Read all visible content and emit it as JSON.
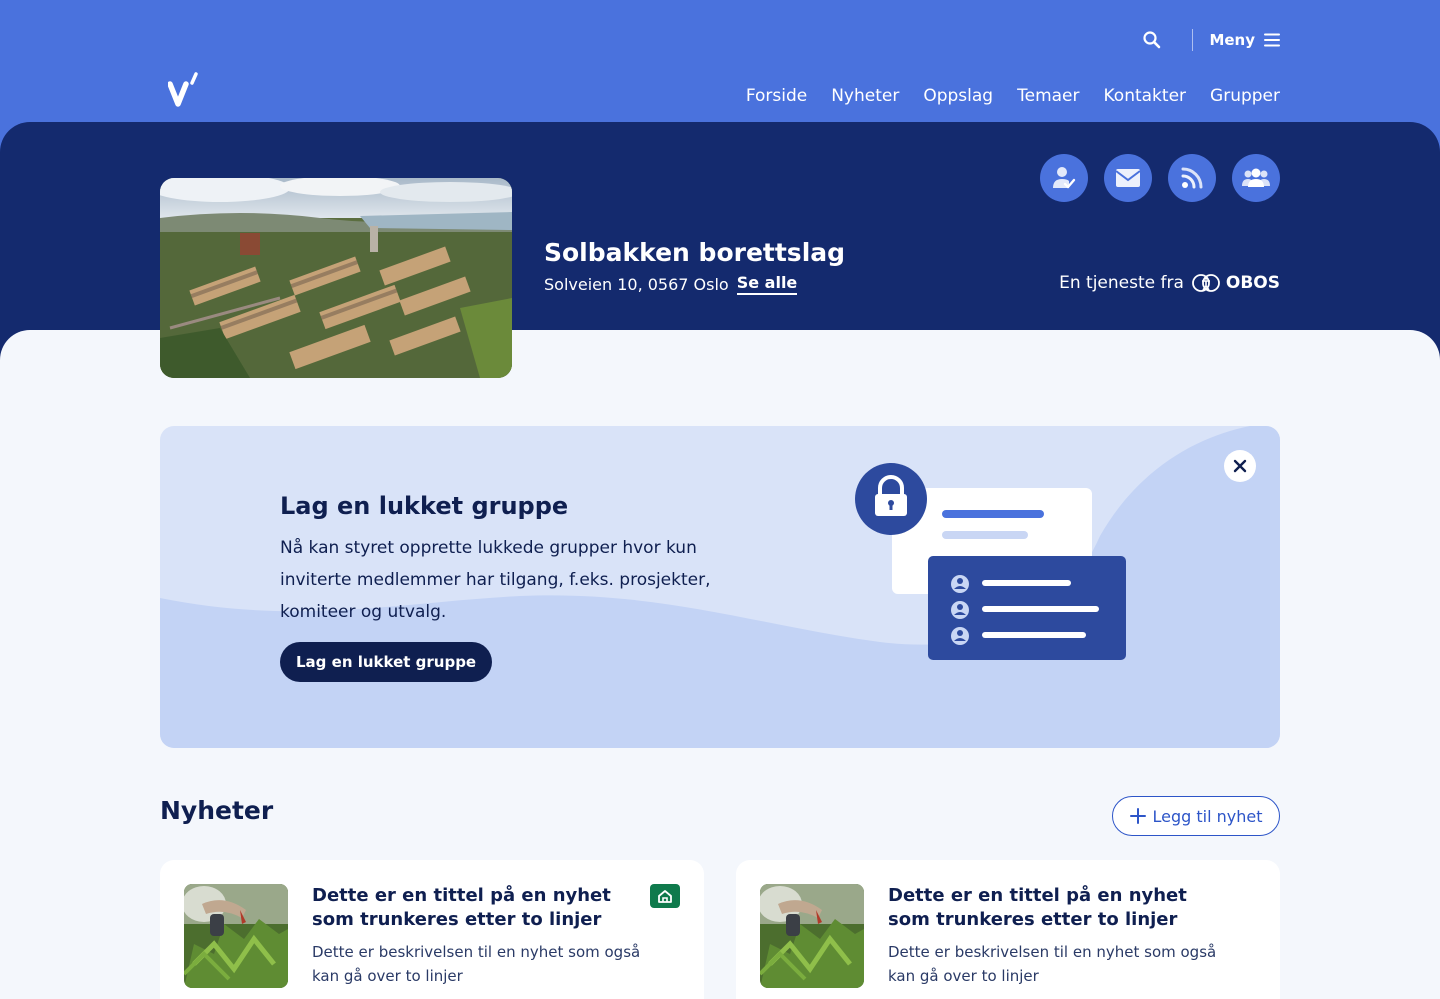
{
  "header": {
    "menu_label": "Meny",
    "nav": [
      "Forside",
      "Nyheter",
      "Oppslag",
      "Temaer",
      "Kontakter",
      "Grupper"
    ]
  },
  "org": {
    "name": "Solbakken borettslag",
    "address": "Solveien 10, 0567 Oslo",
    "see_all": "Se alle",
    "service_prefix": "En tjeneste fra",
    "service_brand": "OBOS"
  },
  "quick_actions": [
    "user-check-icon",
    "envelope-icon",
    "rss-icon",
    "group-icon"
  ],
  "promo": {
    "title": "Lag en lukket gruppe",
    "text": "Nå kan styret opprette lukkede grupper hvor kun inviterte medlemmer har tilgang, f.eks. prosjekter, komiteer og utvalg.",
    "button": "Lag en lukket gruppe"
  },
  "news": {
    "heading": "Nyheter",
    "add_button": "Legg til nyhet",
    "items": [
      {
        "title": "Dette er en tittel på en nyhet som trunkeres etter to linjer",
        "description": "Dette er beskrivelsen til en nyhet som også kan gå over to linjer",
        "badge": true
      },
      {
        "title": "Dette er en tittel på en nyhet som trunkeres etter to linjer",
        "description": "Dette er beskrivelsen til en nyhet som også kan gå over to linjer",
        "badge": false
      }
    ]
  },
  "colors": {
    "top_bar": "#4a72dd",
    "hero": "#142a6e",
    "page_bg": "#f4f7fc",
    "promo_bg": "#d9e3f8",
    "dark_navy": "#0f1f50",
    "badge_green": "#0f7a4c"
  }
}
